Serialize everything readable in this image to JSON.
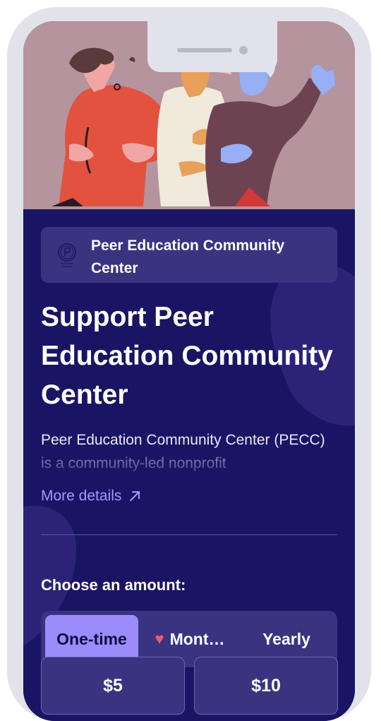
{
  "org": {
    "name": "Peer Education Community Center"
  },
  "page": {
    "title": "Support Peer Education Community Center",
    "description": "Peer Education Community Center (PECC) is a community-led nonprofit",
    "more_details": "More details"
  },
  "donation": {
    "choose_label": "Choose an amount:",
    "frequency": [
      {
        "label": "One-time",
        "selected": true
      },
      {
        "label": "Mont…",
        "selected": false
      },
      {
        "label": "Yearly",
        "selected": false
      }
    ],
    "amounts": [
      "$5",
      "$10"
    ]
  },
  "icons": {
    "org_logo": "org-logo",
    "more_details": "arrow-up-right-icon",
    "monthly": "heart-icon"
  },
  "colors": {
    "hero_bg": "#b5949d",
    "content_bg": "#1a1464",
    "card_bg": "#3a3380",
    "accent": "#9b8bfb",
    "link": "#a797ff",
    "heart": "#ef5b6c"
  }
}
